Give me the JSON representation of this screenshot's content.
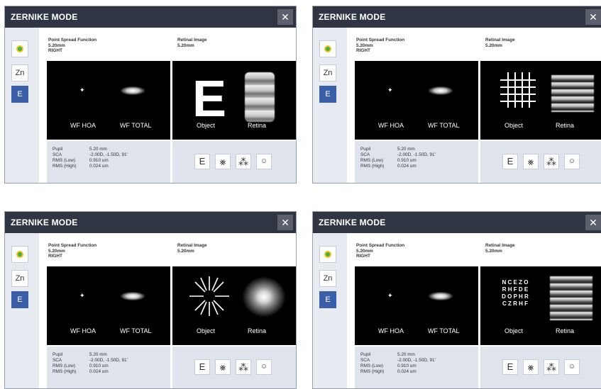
{
  "windows": [
    {
      "title": "ZERNIKE MODE",
      "close": "✕",
      "sidebar": {
        "btn1": "",
        "btn2": "Zn",
        "btn3": "E"
      },
      "headers": {
        "left": [
          "Point Spread Function",
          "5.20mm",
          "RIGHT"
        ],
        "right": [
          "Retinal Image",
          "5.20mm"
        ]
      },
      "psf_labels": [
        "WF HOA",
        "WF TOTAL"
      ],
      "retinal_labels": [
        "Object",
        "Retina"
      ],
      "object_letter": "E",
      "info": [
        {
          "k": "Pupil",
          "v": "5.20 mm"
        },
        {
          "k": "SCA",
          "v": "-2.00D, -1.50D, 91'"
        },
        {
          "k": "RMS (Low)",
          "v": "0.910 um"
        },
        {
          "k": "RMS (High)",
          "v": "0.024 um"
        }
      ],
      "tools": [
        "E",
        "⨳",
        "⁂",
        "☺"
      ]
    },
    {
      "title": "ZERNIKE MODE",
      "close": "✕",
      "sidebar": {
        "btn1": "",
        "btn2": "Zn",
        "btn3": "E"
      },
      "headers": {
        "left": [
          "Point Spread Function",
          "5.20mm",
          "RIGHT"
        ],
        "right": [
          "Retinal Image",
          "5.20mm"
        ]
      },
      "psf_labels": [
        "WF HOA",
        "WF TOTAL"
      ],
      "retinal_labels": [
        "Object",
        "Retina"
      ],
      "info": [
        {
          "k": "Pupil",
          "v": "5.20 mm"
        },
        {
          "k": "SCA",
          "v": "-2.00D, -1.50D, 91'"
        },
        {
          "k": "RMS (Low)",
          "v": "0.910 um"
        },
        {
          "k": "RMS (High)",
          "v": "0.024 um"
        }
      ],
      "tools": [
        "E",
        "⨳",
        "⁂",
        "☺"
      ]
    },
    {
      "title": "ZERNIKE MODE",
      "close": "✕",
      "sidebar": {
        "btn1": "",
        "btn2": "Zn",
        "btn3": "E"
      },
      "headers": {
        "left": [
          "Point Spread Function",
          "5.20mm",
          "RIGHT"
        ],
        "right": [
          "Retinal Image",
          "5.20mm"
        ]
      },
      "psf_labels": [
        "WF HOA",
        "WF TOTAL"
      ],
      "retinal_labels": [
        "Object",
        "Retina"
      ],
      "info": [
        {
          "k": "Pupil",
          "v": "5.20 mm"
        },
        {
          "k": "SCA",
          "v": "-2.00D, -1.50D, 91'"
        },
        {
          "k": "RMS (Low)",
          "v": "0.910 um"
        },
        {
          "k": "RMS (High)",
          "v": "0.024 um"
        }
      ],
      "tools": [
        "E",
        "⨳",
        "⁂",
        "☺"
      ]
    },
    {
      "title": "ZERNIKE MODE",
      "close": "✕",
      "sidebar": {
        "btn1": "",
        "btn2": "Zn",
        "btn3": "E"
      },
      "headers": {
        "left": [
          "Point Spread Function",
          "5.20mm",
          "RIGHT"
        ],
        "right": [
          "Retinal Image",
          "5.20mm"
        ]
      },
      "psf_labels": [
        "WF HOA",
        "WF TOTAL"
      ],
      "retinal_labels": [
        "Object",
        "Retina"
      ],
      "acuity_chart": [
        "N C E Z O",
        "R H F D E",
        "D O P H R",
        "C Z R H F"
      ],
      "info": [
        {
          "k": "Pupil",
          "v": "5.20 mm"
        },
        {
          "k": "SCA",
          "v": "-2.00D, -1.50D, 91'"
        },
        {
          "k": "RMS (Low)",
          "v": "0.910 um"
        },
        {
          "k": "RMS (High)",
          "v": "0.024 um"
        }
      ],
      "tools": [
        "E",
        "⨳",
        "⁂",
        "☺"
      ]
    }
  ],
  "colors": {
    "titlebar": "#2f3542",
    "accent": "#3a5fa8",
    "sidebar_bg": "#e7eaf0",
    "panel_bg": "#000000",
    "info_bg": "#dfe3ec"
  }
}
